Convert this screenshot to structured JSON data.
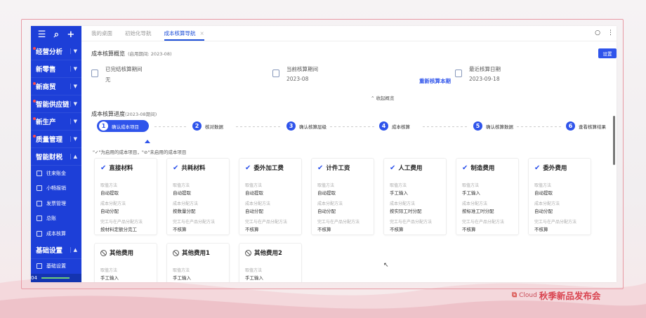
{
  "sidebar": {
    "top_icons": [
      "menu-icon",
      "search-icon",
      "plus-icon"
    ],
    "items": [
      {
        "label": "经营分析",
        "dot": true
      },
      {
        "label": "新零售",
        "dot": false
      },
      {
        "label": "新商贸",
        "dot": true
      },
      {
        "label": "智能供应链",
        "dot": true
      },
      {
        "label": "新生产",
        "dot": true
      },
      {
        "label": "质量管理",
        "dot": true
      },
      {
        "label": "智能财税",
        "dot": false
      }
    ],
    "sub_items": [
      "往来账金",
      "小畅报销",
      "发票管理",
      "总账",
      "成本核算"
    ],
    "bottom_group": {
      "label": "基础设置",
      "sub": "基础设置"
    },
    "bottom_counter": "04"
  },
  "tabs": [
    {
      "label": "我的桌面",
      "active": false
    },
    {
      "label": "初始化导航",
      "active": false
    },
    {
      "label": "成本核算导航",
      "active": true,
      "close": "×"
    }
  ],
  "tab_tools": {
    "search": "○",
    "more": "⋮"
  },
  "overview": {
    "title": "成本核算概览",
    "period": "(启用期间: 2023-08)",
    "settings_button": "设置",
    "items": [
      {
        "label": "已完结核算期间",
        "value": "无"
      },
      {
        "label": "当前核算期间",
        "value": "2023-08"
      },
      {
        "label": "最近核算日期",
        "value": "2023-09-18"
      }
    ],
    "recalc_link": "重新核算本期",
    "collapse": "收起概览"
  },
  "progress": {
    "title": "成本核算进度",
    "period": "(2023-08期间)",
    "steps": [
      {
        "num": "1",
        "label": "确认成本项目",
        "active": true
      },
      {
        "num": "2",
        "label": "核对数据",
        "active": false
      },
      {
        "num": "3",
        "label": "确认核算层级",
        "active": false
      },
      {
        "num": "4",
        "label": "成本核算",
        "active": false
      },
      {
        "num": "5",
        "label": "确认核算数据",
        "active": false
      },
      {
        "num": "6",
        "label": "查看核算结果",
        "active": false
      }
    ],
    "legend": "\"✓\"为启用的成本项目，\"⊘\"未启用的成本项目"
  },
  "cards": [
    {
      "title": "直接材料",
      "enabled": true,
      "method_label": "取值方法",
      "method": "自动提取",
      "alloc_label": "成本分配方法",
      "alloc": "自动分配",
      "finish_label": "完工与在产品分配方法",
      "finish": "按材料定额分完工"
    },
    {
      "title": "共耗材料",
      "enabled": true,
      "method_label": "取值方法",
      "method": "自动提取",
      "alloc_label": "成本分配方法",
      "alloc": "按数量分配",
      "finish_label": "完工与在产品分配方法",
      "finish": "不核算"
    },
    {
      "title": "委外加工费",
      "enabled": true,
      "method_label": "取值方法",
      "method": "自动提取",
      "alloc_label": "成本分配方法",
      "alloc": "自动分配",
      "finish_label": "完工与在产品分配方法",
      "finish": "不核算"
    },
    {
      "title": "计件工资",
      "enabled": true,
      "method_label": "取值方法",
      "method": "自动提取",
      "alloc_label": "成本分配方法",
      "alloc": "自动分配",
      "finish_label": "完工与在产品分配方法",
      "finish": "不核算"
    },
    {
      "title": "人工费用",
      "enabled": true,
      "method_label": "取值方法",
      "method": "手工输入",
      "alloc_label": "成本分配方法",
      "alloc": "按实际工时分配",
      "finish_label": "完工与在产品分配方法",
      "finish": "不核算"
    },
    {
      "title": "制造费用",
      "enabled": true,
      "method_label": "取值方法",
      "method": "手工输入",
      "alloc_label": "成本分配方法",
      "alloc": "按标准工时分配",
      "finish_label": "完工与在产品分配方法",
      "finish": "不核算"
    },
    {
      "title": "委外费用",
      "enabled": true,
      "method_label": "取值方法",
      "method": "自动提取",
      "alloc_label": "成本分配方法",
      "alloc": "自动分配",
      "finish_label": "完工与在产品分配方法",
      "finish": "不核算"
    },
    {
      "title": "其他费用",
      "enabled": false,
      "method_label": "取值方法",
      "method": "手工输入"
    },
    {
      "title": "其他费用1",
      "enabled": false,
      "method_label": "取值方法",
      "method": "手工输入"
    },
    {
      "title": "其他费用2",
      "enabled": false,
      "method_label": "取值方法",
      "method": "手工输入"
    }
  ],
  "branding": {
    "cloud": "Cloud",
    "event": "秋季新品发布会"
  },
  "colors": {
    "primary": "#2f54eb",
    "sidebar": "#1d3fd8",
    "brand_red": "#d9434f"
  }
}
